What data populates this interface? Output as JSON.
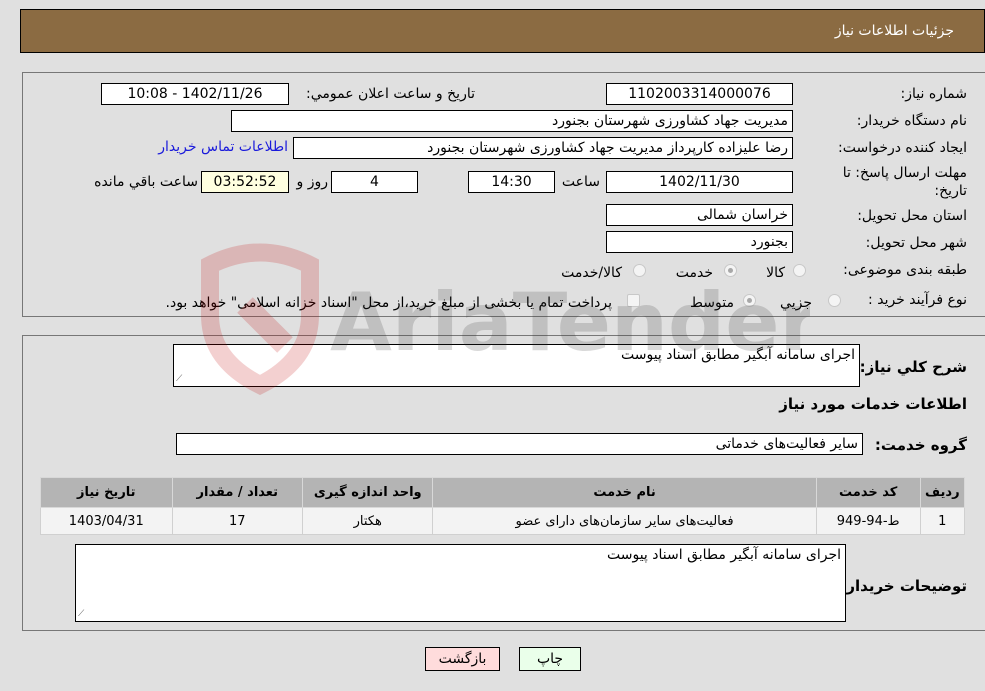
{
  "header": {
    "title": "جزئيات اطلاعات نياز"
  },
  "details": {
    "need_number": {
      "label": "شماره نياز:",
      "value": "1102003314000076"
    },
    "announce_datetime": {
      "label": "تاريخ و ساعت اعلان عمومي:",
      "value": "1402/11/26 - 10:08"
    },
    "buyer_org": {
      "label": "نام دستگاه خريدار:",
      "value": "مديريت جهاد کشاورزی شهرستان بجنورد"
    },
    "requester": {
      "label": "ايجاد کننده درخواست:",
      "value": "رضا  عليزاده کارپرداز مديريت جهاد کشاورزی شهرستان بجنورد"
    },
    "buyer_contact_link": "اطلاعات تماس خريدار",
    "deadline": {
      "label": "مهلت ارسال پاسخ: تا تاريخ:",
      "date": "1402/11/30",
      "time_label": "ساعت",
      "time": "14:30",
      "days": "4",
      "days_label": "روز و",
      "remaining": "03:52:52",
      "remaining_label": "ساعت باقي مانده"
    },
    "province": {
      "label": "استان محل تحويل:",
      "value": "خراسان شمالی"
    },
    "city": {
      "label": "شهر محل تحويل:",
      "value": "بجنورد"
    },
    "category": {
      "label": "طبقه بندی موضوعی:",
      "options": [
        {
          "label": "کالا",
          "checked": false
        },
        {
          "label": "خدمت",
          "checked": true
        },
        {
          "label": "کالا/خدمت",
          "checked": false
        }
      ]
    },
    "purchase_type": {
      "label": "نوع فرآيند خريد :",
      "options": [
        {
          "label": "جزيي",
          "checked": false
        },
        {
          "label": "متوسط",
          "checked": true
        }
      ],
      "treasury_note": "پرداخت تمام يا بخشی از مبلغ خريد،از محل \"اسناد خزانه اسلامی\" خواهد بود.",
      "treasury_checked": false
    }
  },
  "services": {
    "description_label": "شرح کلي نياز:",
    "description": "اجرای سامانه آبگير مطابق اسناد پيوست",
    "section_title": "اطلاعات خدمات مورد نياز",
    "group_label": "گروه خدمت:",
    "group_value": "ساير فعاليت‌های خدماتی",
    "table": {
      "columns": [
        "رديف",
        "کد خدمت",
        "نام خدمت",
        "واحد اندازه گيری",
        "تعداد / مقدار",
        "تاريخ نياز"
      ],
      "rows": [
        [
          "1",
          "ط-94-949",
          "فعاليت‌های ساير سازمان‌های دارای عضو",
          "هکتار",
          "17",
          "1403/04/31"
        ]
      ]
    },
    "buyer_notes_label": "توضيحات خريدار:",
    "buyer_notes": "اجرای سامانه آبگير مطابق اسناد پيوست"
  },
  "buttons": {
    "print": "چاپ",
    "back": "بازگشت"
  },
  "watermark": {
    "text": "AriaTender.net"
  }
}
